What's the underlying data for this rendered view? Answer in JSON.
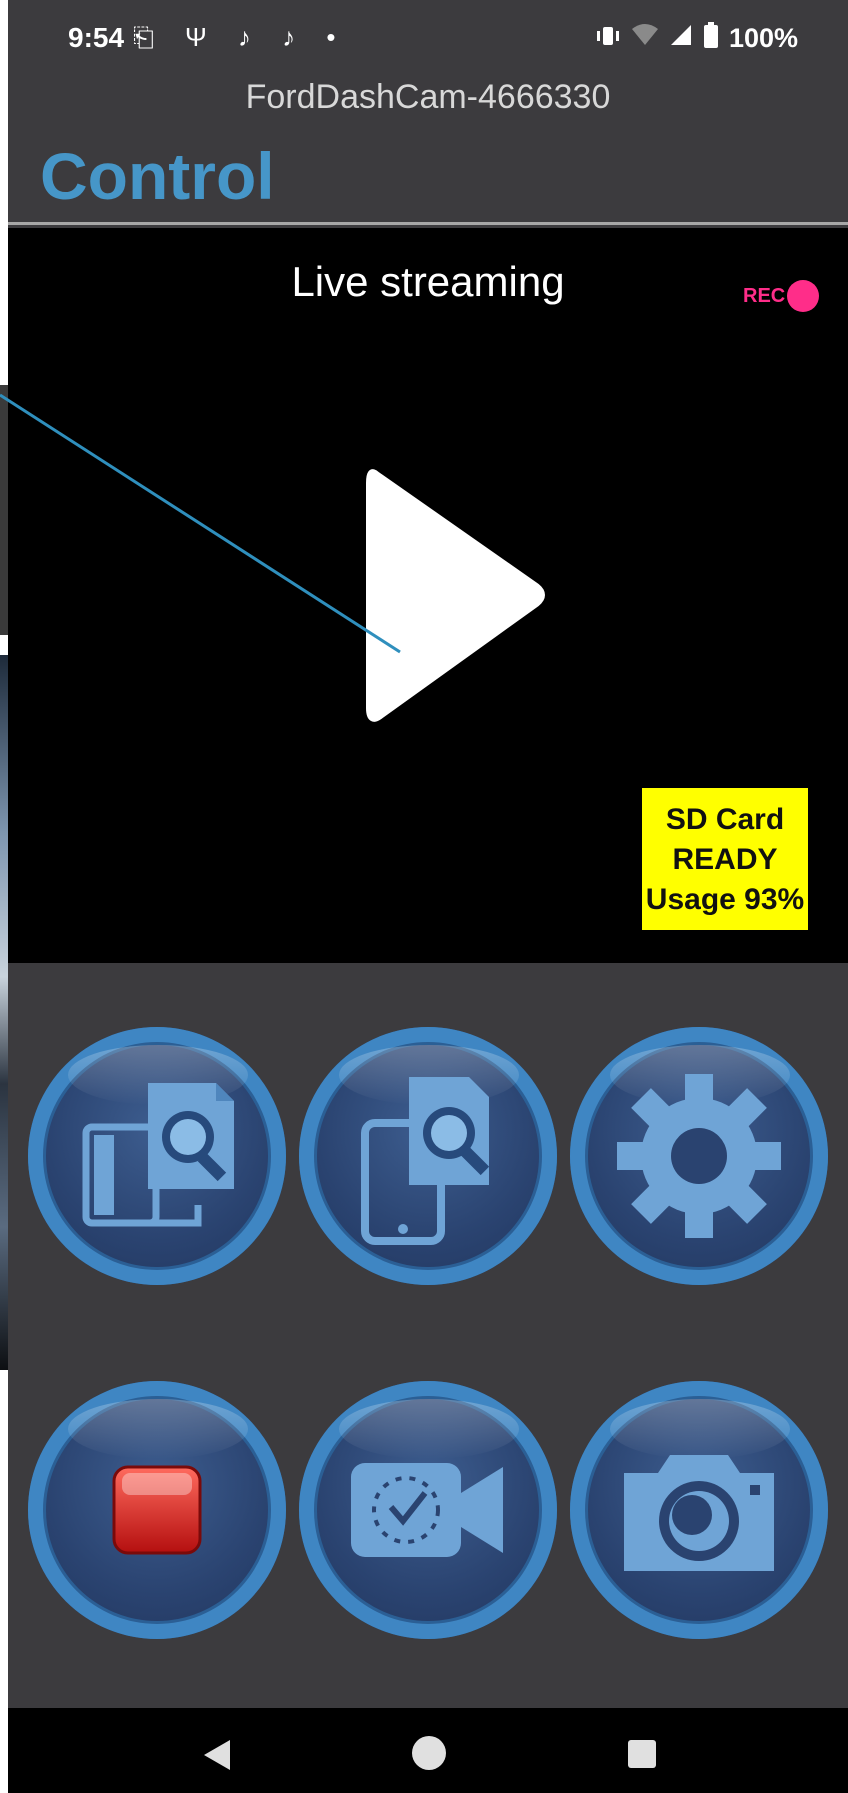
{
  "status_bar": {
    "time": "9:54",
    "left_icons": "⎗ Ψ ♪ ♪ •",
    "battery": "100%"
  },
  "app": {
    "subtitle": "FordDashCam-4666330",
    "title": "Control"
  },
  "video": {
    "label": "Live streaming",
    "rec_text": "REC",
    "sd_card": {
      "line1": "SD Card",
      "line2": "READY",
      "line3": "Usage 93%"
    }
  },
  "colors": {
    "accent": "#4696c8",
    "rec": "#ff2d89",
    "sd_badge": "#ffff00",
    "annotation_line": "#2f8fbd"
  },
  "controls": [
    {
      "icon": "sd-card-browse-icon"
    },
    {
      "icon": "phone-browse-icon"
    },
    {
      "icon": "gear-icon"
    },
    {
      "icon": "stop-record-icon"
    },
    {
      "icon": "timelapse-video-icon"
    },
    {
      "icon": "camera-icon"
    }
  ],
  "navbar": {
    "back": "back-icon",
    "home": "home-icon",
    "recents": "recents-icon"
  }
}
